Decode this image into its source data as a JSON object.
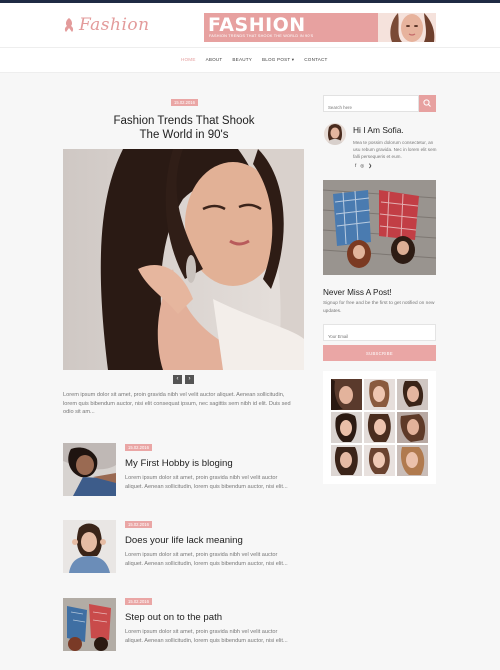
{
  "header": {
    "logo_text": "Fashion",
    "banner": {
      "title": "FASHION",
      "subtitle": "FASHION TRENDS THAT SHOOK THE WORLD IN 90'S"
    }
  },
  "nav": {
    "items": [
      "HOME",
      "ABOUT",
      "BEAUTY",
      "BLOG POST",
      "CONTACT"
    ],
    "active": "HOME"
  },
  "featured": {
    "date": "15.02.2016",
    "title_line1": "Fashion Trends That Shook",
    "title_line2": "The World in 90's",
    "prev_label": "‹",
    "next_label": "›",
    "excerpt": "Lorem ipsum dolor sit amet, proin gravida nibh vel velit auctor aliquet. Aenean sollicitudin, lorem quis bibendum auctor, nisi elit consequat ipsum, nec sagittis sem nibh id elit. Duis sed odio sit am..."
  },
  "posts": [
    {
      "date": "15.02.2016",
      "title": "My First Hobby is bloging",
      "excerpt": "Lorem ipsum dolor sit amet, proin gravida nibh vel velit auctor aliquet. Aenean sollicitudin, lorem quis bibendum auctor, nisi elit..."
    },
    {
      "date": "15.02.2016",
      "title": "Does your life lack meaning",
      "excerpt": "Lorem ipsum dolor sit amet, proin gravida nibh vel velit auctor aliquet. Aenean sollicitudin, lorem quis bibendum auctor, nisi elit..."
    },
    {
      "date": "15.02.2016",
      "title": "Step out on to the path",
      "excerpt": "Lorem ipsum dolor sit amet, proin gravida nibh vel velit auctor aliquet. Aenean sollicitudin, lorem quis bibendum auctor, nisi elit..."
    }
  ],
  "sidebar": {
    "search_placeholder": "Search here",
    "about_title": "Hi I Am Sofia.",
    "about_text": "Mea te possim dolorum consectetur, an usu rebum gravida. Nec in lorem elit sem falli persequeris et eum.",
    "social": [
      "f",
      "◎",
      "❯"
    ],
    "newsletter_title": "Never Miss A Post!",
    "newsletter_text": "Signup for free and be the first to get notified on new updates.",
    "email_placeholder": "Your Email",
    "subscribe_label": "SUBSCRIBE"
  },
  "colors": {
    "accent": "#e7a1a0",
    "nav_dark": "#1f2a44"
  }
}
